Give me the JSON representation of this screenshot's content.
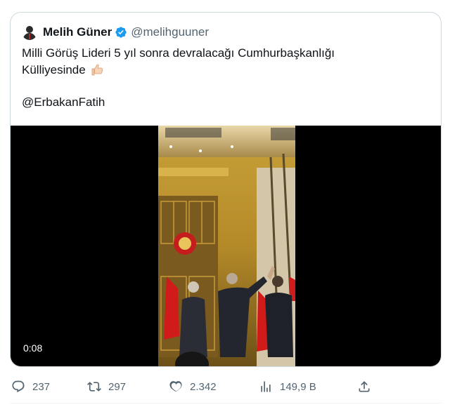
{
  "tweet": {
    "author_name": "Melih Güner",
    "author_handle": "@melihguuner",
    "text_line1": "Milli Görüş Lideri 5 yıl sonra devralacağı Cumhurbaşkanlığı",
    "text_line2": "Külliyesinde",
    "mention": "@ErbakanFatih"
  },
  "video": {
    "timestamp": "0:08"
  },
  "actions": {
    "replies": "237",
    "retweets": "297",
    "likes": "2.342",
    "views": "149,9 B"
  },
  "colors": {
    "verified": "#1d9bf0",
    "muted_text": "#536471",
    "border": "#cfd9de"
  },
  "icons": [
    "verified-badge-icon",
    "thumbs-up-emoji-icon",
    "reply-icon",
    "retweet-icon",
    "like-icon",
    "views-icon",
    "share-icon"
  ]
}
